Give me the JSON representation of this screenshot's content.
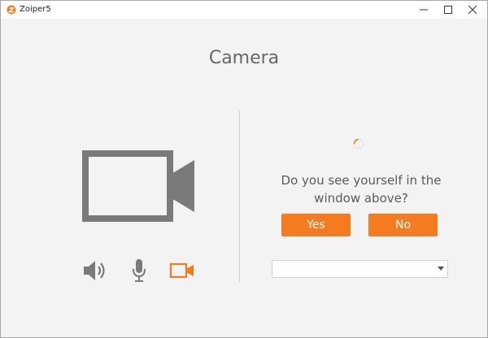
{
  "window": {
    "title": "Zoiper5"
  },
  "page": {
    "title": "Camera"
  },
  "test": {
    "question": "Do you see yourself in the window above?",
    "yes_label": "Yes",
    "no_label": "No"
  },
  "camera_select": {
    "value": ""
  },
  "devices": {
    "speaker_icon": "speaker-icon",
    "microphone_icon": "microphone-icon",
    "camera_icon": "video-camera-icon",
    "active": "camera"
  },
  "colors": {
    "accent": "#f47b20",
    "icon_gray": "#7a7a7a",
    "background": "#f3f3f3"
  }
}
